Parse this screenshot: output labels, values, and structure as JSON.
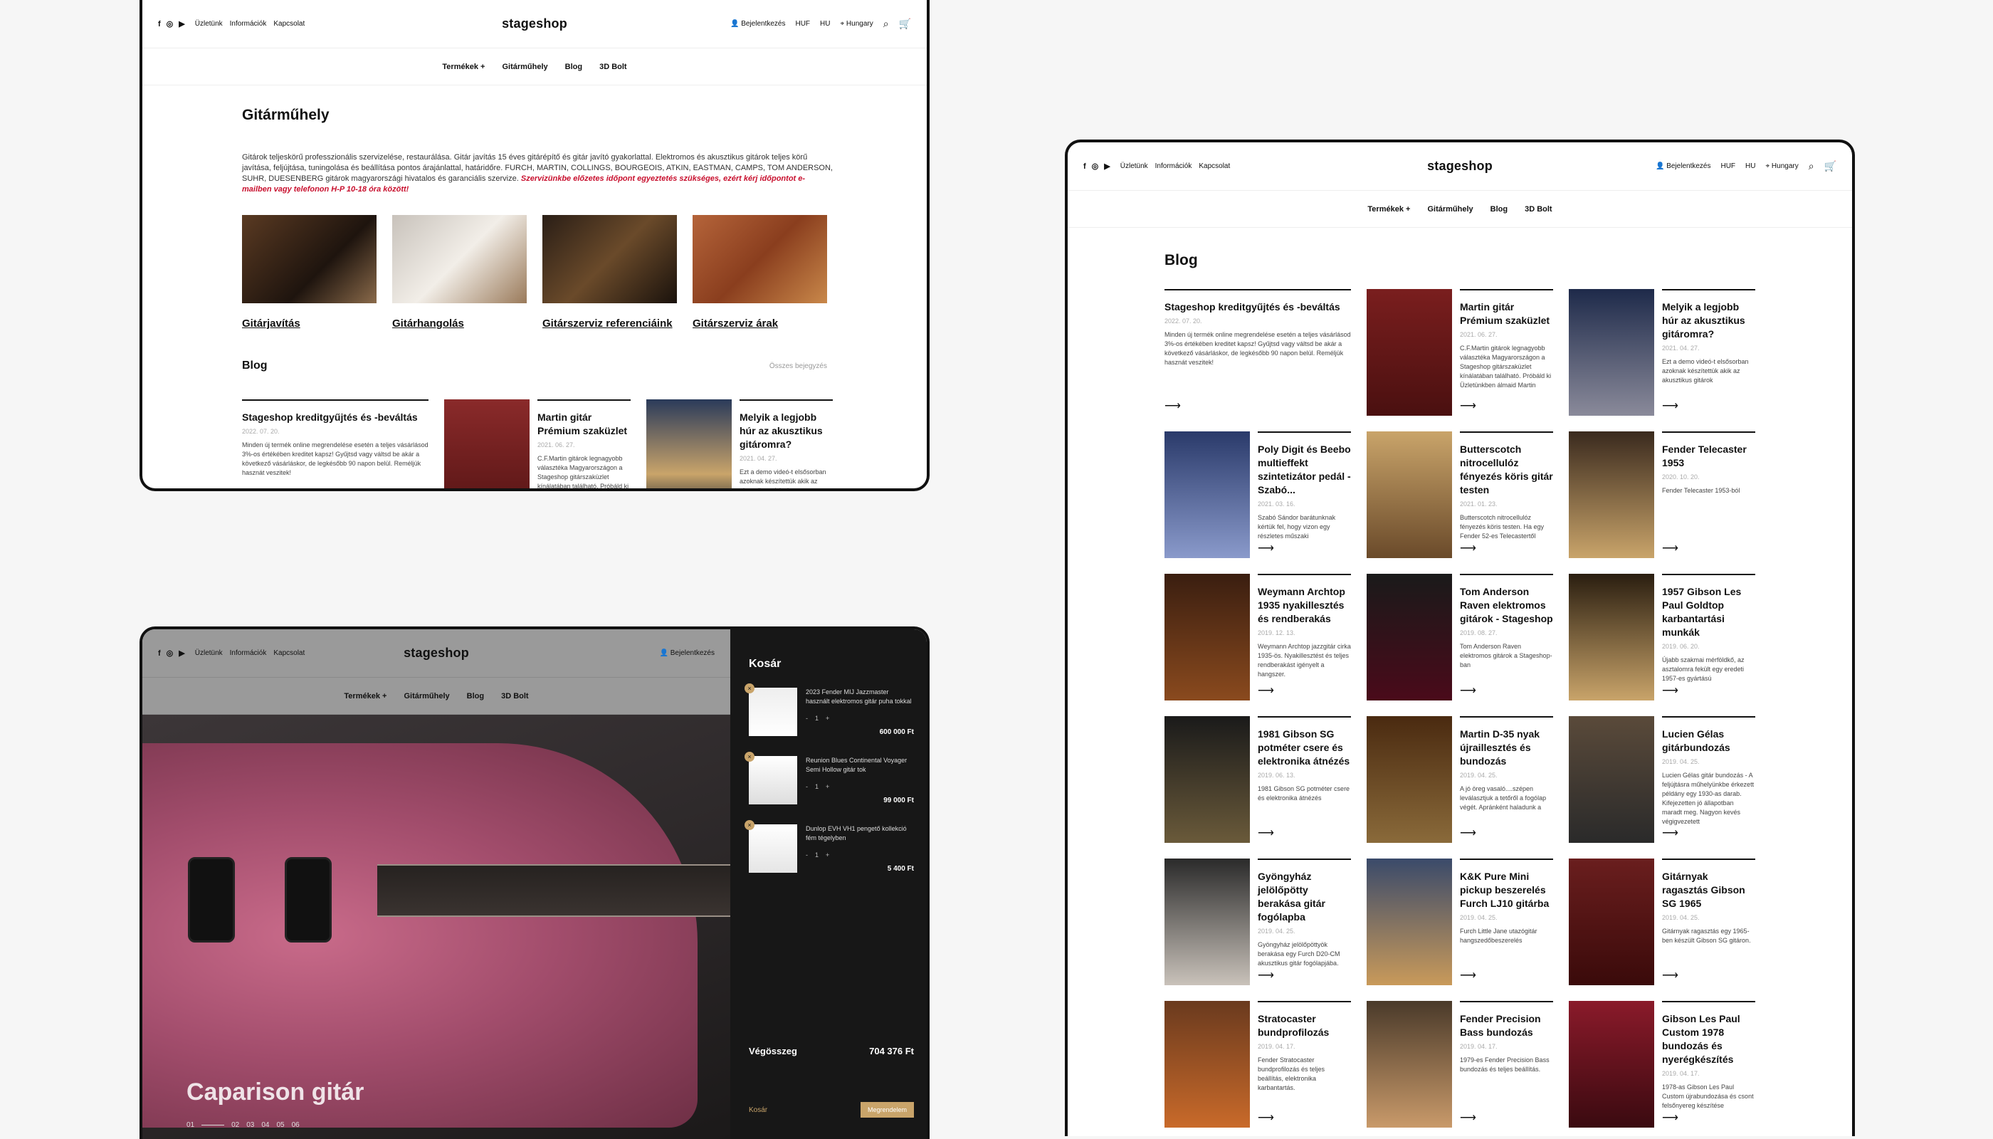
{
  "header": {
    "social": [
      "f",
      "◎",
      "▶"
    ],
    "links": [
      "Üzletünk",
      "Információk",
      "Kapcsolat"
    ],
    "logo": "stageshop",
    "login": "Bejelentkezés",
    "currency": "HUF",
    "lang": "HU",
    "country": "Hungary"
  },
  "nav": [
    "Termékek +",
    "Gitárműhely",
    "Blog",
    "3D Bolt"
  ],
  "workshop": {
    "title": "Gitárműhely",
    "intro": "Gitárok teljeskörű professzionális szervizelése, restaurálása. Gitár javítás 15 éves gitárépítő és gitár javító gyakorlattal. Elektromos és akusztikus gitárok teljes körű javítása, feljújtása, tuningolása és beállítása pontos árajánlattal, határidőre. FURCH, MARTIN, COLLINGS, BOURGEOIS, ATKIN, EASTMAN, CAMPS, TOM ANDERSON, SUHR, DUESENBERG gitárok magyarországi hivatalos és garanciális szervize.",
    "intro_red": "Szervizünkbe előzetes időpont egyeztetés szükséges, ezért kérj időpontot e-mailben vagy telefonon H-P 10-18 óra között!",
    "services": [
      "Gitárjavítás",
      "Gitárhangolás",
      "Gitárszerviz referenciáink",
      "Gitárszerviz árak"
    ],
    "blog_title": "Blog",
    "all_posts": "Összes bejegyzés"
  },
  "blog_page": {
    "title": "Blog"
  },
  "posts": [
    {
      "title": "Stageshop kreditgyűjtés és -beváltás",
      "date": "2022. 07. 20.",
      "excerpt": "Minden új termék online megrendelése esetén a teljes vásárlásod 3%-os értékében kreditet kapsz! Gyűjtsd vagy váltsd be akár a következő vásárláskor, de legkésőbb 90 napon belül. Reméljük hasznát veszitek!"
    },
    {
      "title": "Martin gitár Prémium szaküzlet",
      "date": "2021. 06. 27.",
      "excerpt": "C.F.Martin gitárok legnagyobb választéka Magyarországon a Stageshop gitárszaküzlet kínálatában található. Próbáld ki Üzletünkben álmaid Martin"
    },
    {
      "title": "Melyik a legjobb húr az akusztikus gitáromra?",
      "date": "2021. 04. 27.",
      "excerpt": "Ezt a demo videó-t elsősorban azoknak készítettük akik az akusztikus gitárok"
    },
    {
      "title": "Poly Digit és Beebo multieffekt szintetizátor pedál - Szabó...",
      "date": "2021. 03. 16.",
      "excerpt": "Szabó Sándor barátunknak kértük fel, hogy vizon egy részletes műszaki"
    },
    {
      "title": "Butterscotch nitrocellulóz fényezés köris gitár testen",
      "date": "2021. 01. 23.",
      "excerpt": "Butterscotch nitrocellulóz fényezés köris testen. Ha egy Fender 52-es Telecastertől"
    },
    {
      "title": "Fender Telecaster 1953",
      "date": "2020. 10. 20.",
      "excerpt": "Fender Telecaster 1953-ból"
    },
    {
      "title": "Weymann Archtop 1935 nyakillesztés és rendberakás",
      "date": "2019. 12. 13.",
      "excerpt": "Weymann Archtop jazzgitár cirka 1935-ös. Nyakillesztést és teljes rendberakást igényelt a hangszer."
    },
    {
      "title": "Tom Anderson Raven elektromos gitárok - Stageshop",
      "date": "2019. 08. 27.",
      "excerpt": "Tom Anderson Raven elektromos gitárok a Stageshop-ban"
    },
    {
      "title": "1957 Gibson Les Paul Goldtop karbantartási munkák",
      "date": "2019. 06. 20.",
      "excerpt": "Újabb szakmai mérföldkő, az asztalomra fekült egy eredeti 1957-es gyártású"
    },
    {
      "title": "1981 Gibson SG potméter csere és elektronika átnézés",
      "date": "2019. 06. 13.",
      "excerpt": "1981 Gibson SG potméter csere és elektronika átnézés"
    },
    {
      "title": "Martin D-35 nyak újraillesztés és bundozás",
      "date": "2019. 04. 25.",
      "excerpt": "A jó öreg vasaló....szépen leválasztjuk a tetőről a fogólap végét. Apránként haladunk a"
    },
    {
      "title": "Lucien Gélas gitárbundozás",
      "date": "2019. 04. 25.",
      "excerpt": "Lucien Gélas gitár bundozás - A feljújtásra műhelyünkbe érkezett példány egy 1930-as darab. Kifejezetten jó állapotban maradt meg. Nagyon kevés végigvezetett"
    },
    {
      "title": "Gyöngyház jelölőpötty berakása gitár fogólapba",
      "date": "2019. 04. 25.",
      "excerpt": "Gyöngyház jelölőpöttyök berakása egy Furch D20-CM akusztikus gitár fogólapjába."
    },
    {
      "title": "K&K Pure Mini pickup beszerelés Furch LJ10 gitárba",
      "date": "2019. 04. 25.",
      "excerpt": "Furch Little Jane utazógitár hangszedőbeszerelés"
    },
    {
      "title": "Gitárnyak ragasztás Gibson SG 1965",
      "date": "2019. 04. 25.",
      "excerpt": "Gitárnyak ragasztás egy 1965-ben készült Gibson SG gitáron."
    },
    {
      "title": "Stratocaster bundprofilozás",
      "date": "2019. 04. 17.",
      "excerpt": "Fender Stratocaster bundprofilozás és teljes beállítás, elektronika karbantartás."
    },
    {
      "title": "Fender Precision Bass bundozás",
      "date": "2019. 04. 17.",
      "excerpt": "1979-es Fender Precision Bass bundozás és teljes beállítás."
    },
    {
      "title": "Gibson Les Paul Custom 1978 bundozás és nyerégkészítés",
      "date": "2019. 04. 17.",
      "excerpt": "1978-as Gibson Les Paul Custom újrabundozása és csont felsőnyereg készítése"
    }
  ],
  "hero": {
    "title": "Caparison gitár",
    "pages": [
      "01",
      "02",
      "03",
      "04",
      "05",
      "06"
    ]
  },
  "cart": {
    "title": "Kosár",
    "items": [
      {
        "name": "2023 Fender MIJ Jazzmaster használt elektromos gitár puha tokkal",
        "qty": "1",
        "price": "600 000 Ft"
      },
      {
        "name": "Reunion Blues Continental Voyager Semi Hollow gitár tok",
        "qty": "1",
        "price": "99 000 Ft"
      },
      {
        "name": "Dunlop EVH VH1 pengető kollekció fém tégelyben",
        "qty": "1",
        "price": "5 400 Ft"
      }
    ],
    "total_label": "Végösszeg",
    "total": "704 376 Ft",
    "cart_link": "Kosár",
    "checkout": "Megrendelem"
  },
  "colors": {
    "accent": "#c9a46a",
    "red": "#c8102e",
    "dark": "#171717"
  }
}
